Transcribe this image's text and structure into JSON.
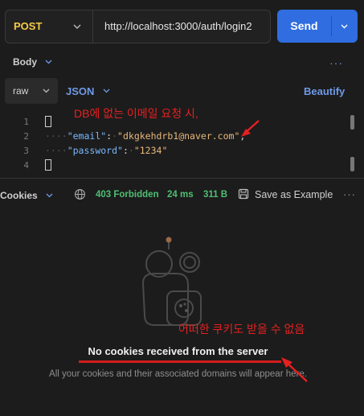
{
  "request": {
    "method": "POST",
    "url": "http://localhost:3000/auth/login2",
    "send_label": "Send"
  },
  "body_tabs": {
    "body_label": "Body",
    "more": "···",
    "format_label": "raw",
    "language_label": "JSON",
    "beautify_label": "Beautify"
  },
  "editor": {
    "line_numbers": [
      "1",
      "2",
      "3",
      "4"
    ],
    "email_key": "\"email\"",
    "email_value": "\"dkgkehdrb1@naver.com\"",
    "password_key": "\"password\"",
    "password_value": "\"1234\""
  },
  "response": {
    "cookies_label": "Cookies",
    "status": "403 Forbidden",
    "time": "24 ms",
    "size": "311 B",
    "save_label": "Save as Example",
    "more": "···"
  },
  "empty_state": {
    "title": "No cookies received from the server",
    "subtitle": "All your cookies and their associated domains will appear here."
  },
  "annotations": {
    "note1": "DB에 없는 이메일 요청 시,",
    "note2": "어떠한 쿠키도 받을 수 없음"
  },
  "colors": {
    "accent": "#2f6de0",
    "method": "#f7c948",
    "status_ok": "#4fbf73",
    "annotation": "#e62020"
  }
}
